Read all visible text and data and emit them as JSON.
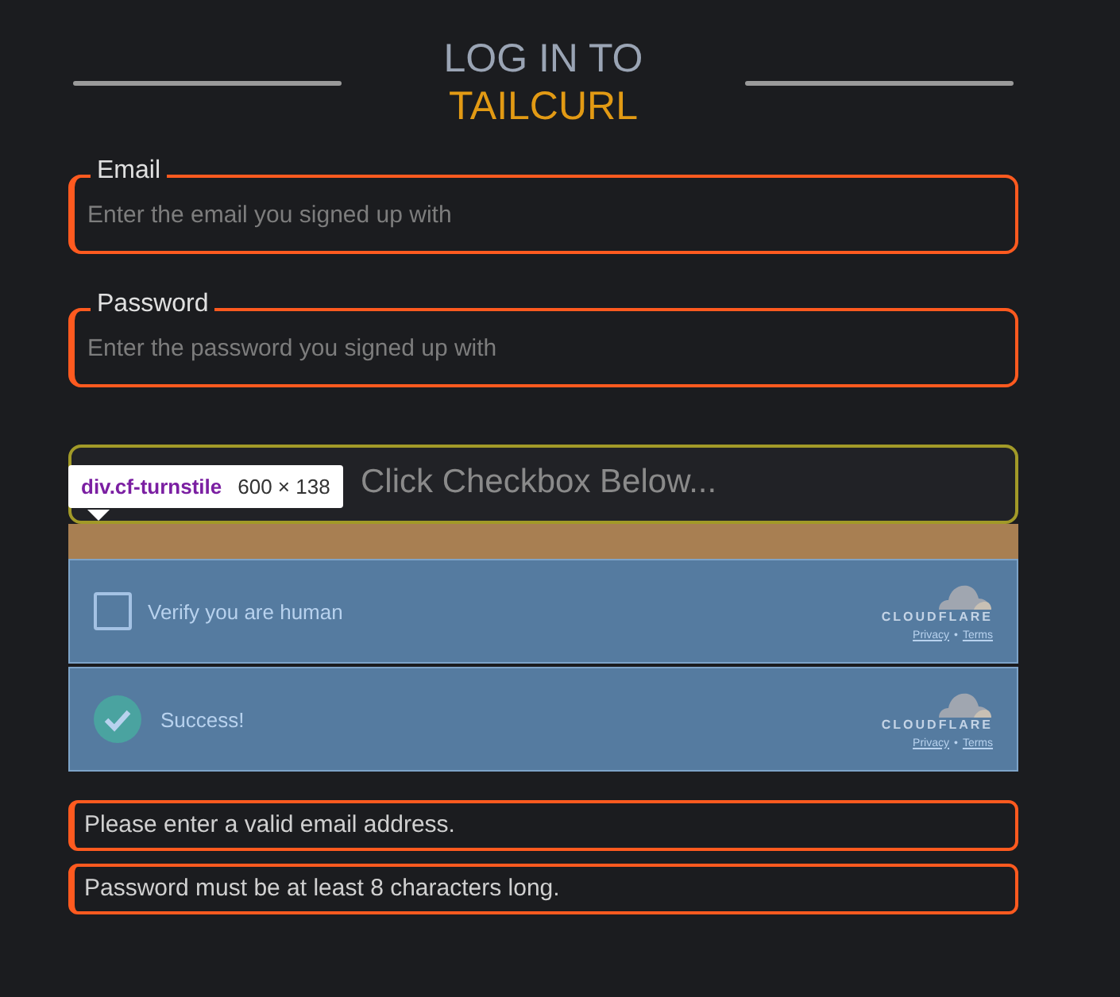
{
  "title": {
    "line1": "LOG IN TO",
    "line2": "TAILCURL"
  },
  "fields": [
    {
      "label": "Email",
      "placeholder": "Enter the email you signed up with"
    },
    {
      "label": "Password",
      "placeholder": "Enter the password you signed up with"
    }
  ],
  "captcha_prompt": "Click Checkbox Below...",
  "inspector_tooltip": {
    "selector": "div.cf-turnstile",
    "size": "600 × 138"
  },
  "widgets": [
    {
      "checked": false,
      "label": "Verify you are human",
      "brand": "CLOUDFLARE",
      "links": [
        "Privacy",
        "Terms"
      ],
      "separator": "•"
    },
    {
      "checked": true,
      "label": "Success!",
      "brand": "CLOUDFLARE",
      "links": [
        "Privacy",
        "Terms"
      ],
      "separator": "•"
    }
  ],
  "errors": [
    "Please enter a valid email address.",
    "Password must be at least 8 characters long."
  ]
}
